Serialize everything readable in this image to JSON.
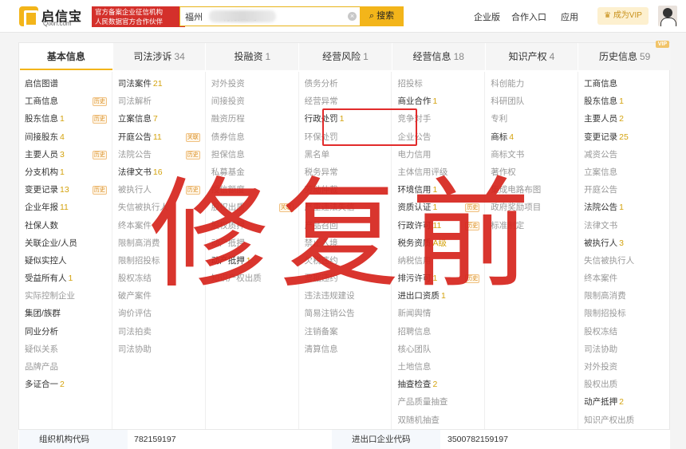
{
  "header": {
    "logo_cn": "启信宝",
    "logo_en": "Qixin.com",
    "slogan_line1": "官方备案企业征信机构",
    "slogan_line2": "人民数据官方合作伙伴",
    "search_value": "福州        有限公司",
    "search_button": "搜索",
    "nav": [
      "企业版",
      "合作入口",
      "应用"
    ],
    "vip_button": "成为VIP"
  },
  "tabs": [
    {
      "label": "基本信息",
      "count": ""
    },
    {
      "label": "司法涉诉",
      "count": "34"
    },
    {
      "label": "投融资",
      "count": "1"
    },
    {
      "label": "经营风险",
      "count": "1"
    },
    {
      "label": "经营信息",
      "count": "18"
    },
    {
      "label": "知识产权",
      "count": "4"
    },
    {
      "label": "历史信息",
      "count": "59"
    }
  ],
  "vip_tag": "VIP",
  "columns": [
    [
      {
        "label": "启信图谱",
        "num": "",
        "tag": "",
        "on": true
      },
      {
        "label": "工商信息",
        "num": "",
        "tag": "历史",
        "on": true
      },
      {
        "label": "股东信息",
        "num": "1",
        "tag": "历史",
        "on": true
      },
      {
        "label": "间接股东",
        "num": "4",
        "tag": "",
        "on": true
      },
      {
        "label": "主要人员",
        "num": "3",
        "tag": "历史",
        "on": true
      },
      {
        "label": "分支机构",
        "num": "1",
        "tag": "",
        "on": true
      },
      {
        "label": "变更记录",
        "num": "13",
        "tag": "历史",
        "on": true
      },
      {
        "label": "企业年报",
        "num": "11",
        "tag": "",
        "on": true
      },
      {
        "label": "社保人数",
        "num": "",
        "tag": "",
        "on": true
      },
      {
        "label": "关联企业/人员",
        "num": "",
        "tag": "",
        "on": true
      },
      {
        "label": "疑似实控人",
        "num": "",
        "tag": "",
        "on": true
      },
      {
        "label": "受益所有人",
        "num": "1",
        "tag": "",
        "on": true
      },
      {
        "label": "实际控制企业",
        "num": "",
        "tag": "",
        "on": false
      },
      {
        "label": "集团/族群",
        "num": "",
        "tag": "",
        "on": true
      },
      {
        "label": "同业分析",
        "num": "",
        "tag": "",
        "on": true
      },
      {
        "label": "疑似关系",
        "num": "",
        "tag": "",
        "on": false
      },
      {
        "label": "品牌产品",
        "num": "",
        "tag": "",
        "on": false
      },
      {
        "label": "多证合一",
        "num": "2",
        "tag": "",
        "on": true
      }
    ],
    [
      {
        "label": "司法案件",
        "num": "21",
        "tag": "",
        "on": true
      },
      {
        "label": "司法解析",
        "num": "",
        "tag": "",
        "on": false
      },
      {
        "label": "立案信息",
        "num": "7",
        "tag": "",
        "on": true
      },
      {
        "label": "开庭公告",
        "num": "11",
        "tag": "关联",
        "on": true
      },
      {
        "label": "法院公告",
        "num": "",
        "tag": "历史",
        "on": false
      },
      {
        "label": "法律文书",
        "num": "16",
        "tag": "",
        "on": true
      },
      {
        "label": "被执行人",
        "num": "",
        "tag": "历史",
        "on": false
      },
      {
        "label": "失信被执行人",
        "num": "",
        "tag": "",
        "on": false
      },
      {
        "label": "终本案件",
        "num": "",
        "tag": "",
        "on": false
      },
      {
        "label": "限制高消费",
        "num": "",
        "tag": "",
        "on": false
      },
      {
        "label": "限制招投标",
        "num": "",
        "tag": "",
        "on": false
      },
      {
        "label": "股权冻结",
        "num": "",
        "tag": "",
        "on": false
      },
      {
        "label": "破产案件",
        "num": "",
        "tag": "",
        "on": false
      },
      {
        "label": "询价评估",
        "num": "",
        "tag": "",
        "on": false
      },
      {
        "label": "司法拍卖",
        "num": "",
        "tag": "",
        "on": false
      },
      {
        "label": "司法协助",
        "num": "",
        "tag": "",
        "on": false
      }
    ],
    [
      {
        "label": "对外投资",
        "num": "",
        "tag": "",
        "on": false
      },
      {
        "label": "间接投资",
        "num": "",
        "tag": "",
        "on": false
      },
      {
        "label": "融资历程",
        "num": "",
        "tag": "",
        "on": false
      },
      {
        "label": "债券信息",
        "num": "",
        "tag": "",
        "on": false
      },
      {
        "label": "担保信息",
        "num": "",
        "tag": "",
        "on": false
      },
      {
        "label": "私募基金",
        "num": "",
        "tag": "",
        "on": false
      },
      {
        "label": "授信额度",
        "num": "",
        "tag": "",
        "on": false
      },
      {
        "label": "股权出质",
        "num": "",
        "tag": "关联",
        "on": false
      },
      {
        "label": "股权质押",
        "num": "",
        "tag": "",
        "on": false
      },
      {
        "label": "动产抵押",
        "num": "",
        "tag": "",
        "on": false
      },
      {
        "label": "动产抵押",
        "num": "1",
        "tag": "",
        "on": true
      },
      {
        "label": "知识产权出质",
        "num": "",
        "tag": "",
        "on": false
      }
    ],
    [
      {
        "label": "债务分析",
        "num": "",
        "tag": "",
        "on": false
      },
      {
        "label": "经营异常",
        "num": "",
        "tag": "",
        "on": false
      },
      {
        "label": "行政处罚",
        "num": "1",
        "tag": "",
        "on": true
      },
      {
        "label": "环保处罚",
        "num": "",
        "tag": "",
        "on": false
      },
      {
        "label": "黑名单",
        "num": "",
        "tag": "",
        "on": false
      },
      {
        "label": "税务异常",
        "num": "",
        "tag": "",
        "on": false
      },
      {
        "label": "劳动仲裁",
        "num": "",
        "tag": "",
        "on": false
      },
      {
        "label": "严重违法失信",
        "num": "",
        "tag": "",
        "on": false
      },
      {
        "label": "产品召回",
        "num": "",
        "tag": "",
        "on": false
      },
      {
        "label": "禁止入境",
        "num": "",
        "tag": "",
        "on": false
      },
      {
        "label": "欠税违约",
        "num": "",
        "tag": "",
        "on": false
      },
      {
        "label": "票据违约",
        "num": "",
        "tag": "",
        "on": false
      },
      {
        "label": "违法违规建设",
        "num": "",
        "tag": "",
        "on": false
      },
      {
        "label": "简易注销公告",
        "num": "",
        "tag": "",
        "on": false
      },
      {
        "label": "注销备案",
        "num": "",
        "tag": "",
        "on": false
      },
      {
        "label": "清算信息",
        "num": "",
        "tag": "",
        "on": false
      }
    ],
    [
      {
        "label": "招投标",
        "num": "",
        "tag": "",
        "on": false
      },
      {
        "label": "商业合作",
        "num": "1",
        "tag": "",
        "on": true
      },
      {
        "label": "竞争对手",
        "num": "",
        "tag": "",
        "on": false
      },
      {
        "label": "企业公告",
        "num": "",
        "tag": "",
        "on": false
      },
      {
        "label": "电力信用",
        "num": "",
        "tag": "",
        "on": false
      },
      {
        "label": "主体信用评级",
        "num": "",
        "tag": "",
        "on": false
      },
      {
        "label": "环境信用",
        "num": "1",
        "tag": "",
        "on": true
      },
      {
        "label": "资质认证",
        "num": "1",
        "tag": "历史",
        "on": true
      },
      {
        "label": "行政许可",
        "num": "11",
        "tag": "历史",
        "on": true
      },
      {
        "label": "税务资质",
        "num": "A级",
        "tag": "",
        "on": true
      },
      {
        "label": "纳税信用",
        "num": "",
        "tag": "",
        "on": false
      },
      {
        "label": "排污许可",
        "num": "1",
        "tag": "历史",
        "on": true
      },
      {
        "label": "进出口资质",
        "num": "1",
        "tag": "",
        "on": true
      },
      {
        "label": "新闻舆情",
        "num": "",
        "tag": "",
        "on": false
      },
      {
        "label": "招聘信息",
        "num": "",
        "tag": "",
        "on": false
      },
      {
        "label": "核心团队",
        "num": "",
        "tag": "",
        "on": false
      },
      {
        "label": "土地信息",
        "num": "",
        "tag": "",
        "on": false
      },
      {
        "label": "抽查检查",
        "num": "2",
        "tag": "",
        "on": true
      },
      {
        "label": "产品质量抽查",
        "num": "",
        "tag": "",
        "on": false
      },
      {
        "label": "双随机抽查",
        "num": "",
        "tag": "",
        "on": false
      }
    ],
    [
      {
        "label": "科创能力",
        "num": "",
        "tag": "",
        "on": false
      },
      {
        "label": "科研团队",
        "num": "",
        "tag": "",
        "on": false
      },
      {
        "label": "专利",
        "num": "",
        "tag": "",
        "on": false
      },
      {
        "label": "商标",
        "num": "4",
        "tag": "",
        "on": true
      },
      {
        "label": "商标文书",
        "num": "",
        "tag": "",
        "on": false
      },
      {
        "label": "著作权",
        "num": "",
        "tag": "",
        "on": false
      },
      {
        "label": "集成电路布图",
        "num": "",
        "tag": "",
        "on": false
      },
      {
        "label": "政府奖励项目",
        "num": "",
        "tag": "",
        "on": false
      },
      {
        "label": "标准制定",
        "num": "",
        "tag": "",
        "on": false
      }
    ],
    [
      {
        "label": "工商信息",
        "num": "",
        "tag": "",
        "on": true
      },
      {
        "label": "股东信息",
        "num": "1",
        "tag": "",
        "on": true
      },
      {
        "label": "主要人员",
        "num": "2",
        "tag": "",
        "on": true
      },
      {
        "label": "变更记录",
        "num": "25",
        "tag": "",
        "on": true
      },
      {
        "label": "减资公告",
        "num": "",
        "tag": "",
        "on": false
      },
      {
        "label": "立案信息",
        "num": "",
        "tag": "",
        "on": false
      },
      {
        "label": "开庭公告",
        "num": "",
        "tag": "",
        "on": false
      },
      {
        "label": "法院公告",
        "num": "1",
        "tag": "",
        "on": true
      },
      {
        "label": "法律文书",
        "num": "",
        "tag": "",
        "on": false
      },
      {
        "label": "被执行人",
        "num": "3",
        "tag": "",
        "on": true
      },
      {
        "label": "失信被执行人",
        "num": "",
        "tag": "",
        "on": false
      },
      {
        "label": "终本案件",
        "num": "",
        "tag": "",
        "on": false
      },
      {
        "label": "限制高消费",
        "num": "",
        "tag": "",
        "on": false
      },
      {
        "label": "限制招投标",
        "num": "",
        "tag": "",
        "on": false
      },
      {
        "label": "股权冻结",
        "num": "",
        "tag": "",
        "on": false
      },
      {
        "label": "司法协助",
        "num": "",
        "tag": "",
        "on": false
      },
      {
        "label": "对外投资",
        "num": "",
        "tag": "",
        "on": false
      },
      {
        "label": "股权出质",
        "num": "",
        "tag": "",
        "on": false
      },
      {
        "label": "动产抵押",
        "num": "2",
        "tag": "",
        "on": true
      },
      {
        "label": "知识产权出质",
        "num": "",
        "tag": "",
        "on": false
      }
    ]
  ],
  "watermark": "修复前",
  "bottom_row": {
    "label1": "组织机构代码",
    "value1": "782159197",
    "label2": "进出口企业代码",
    "value2": "3500782159197"
  },
  "colors": {
    "accent": "#f3b51a",
    "count_color": "#d4a30f",
    "highlight": "#e22b2b",
    "watermark": "#d6241c"
  }
}
